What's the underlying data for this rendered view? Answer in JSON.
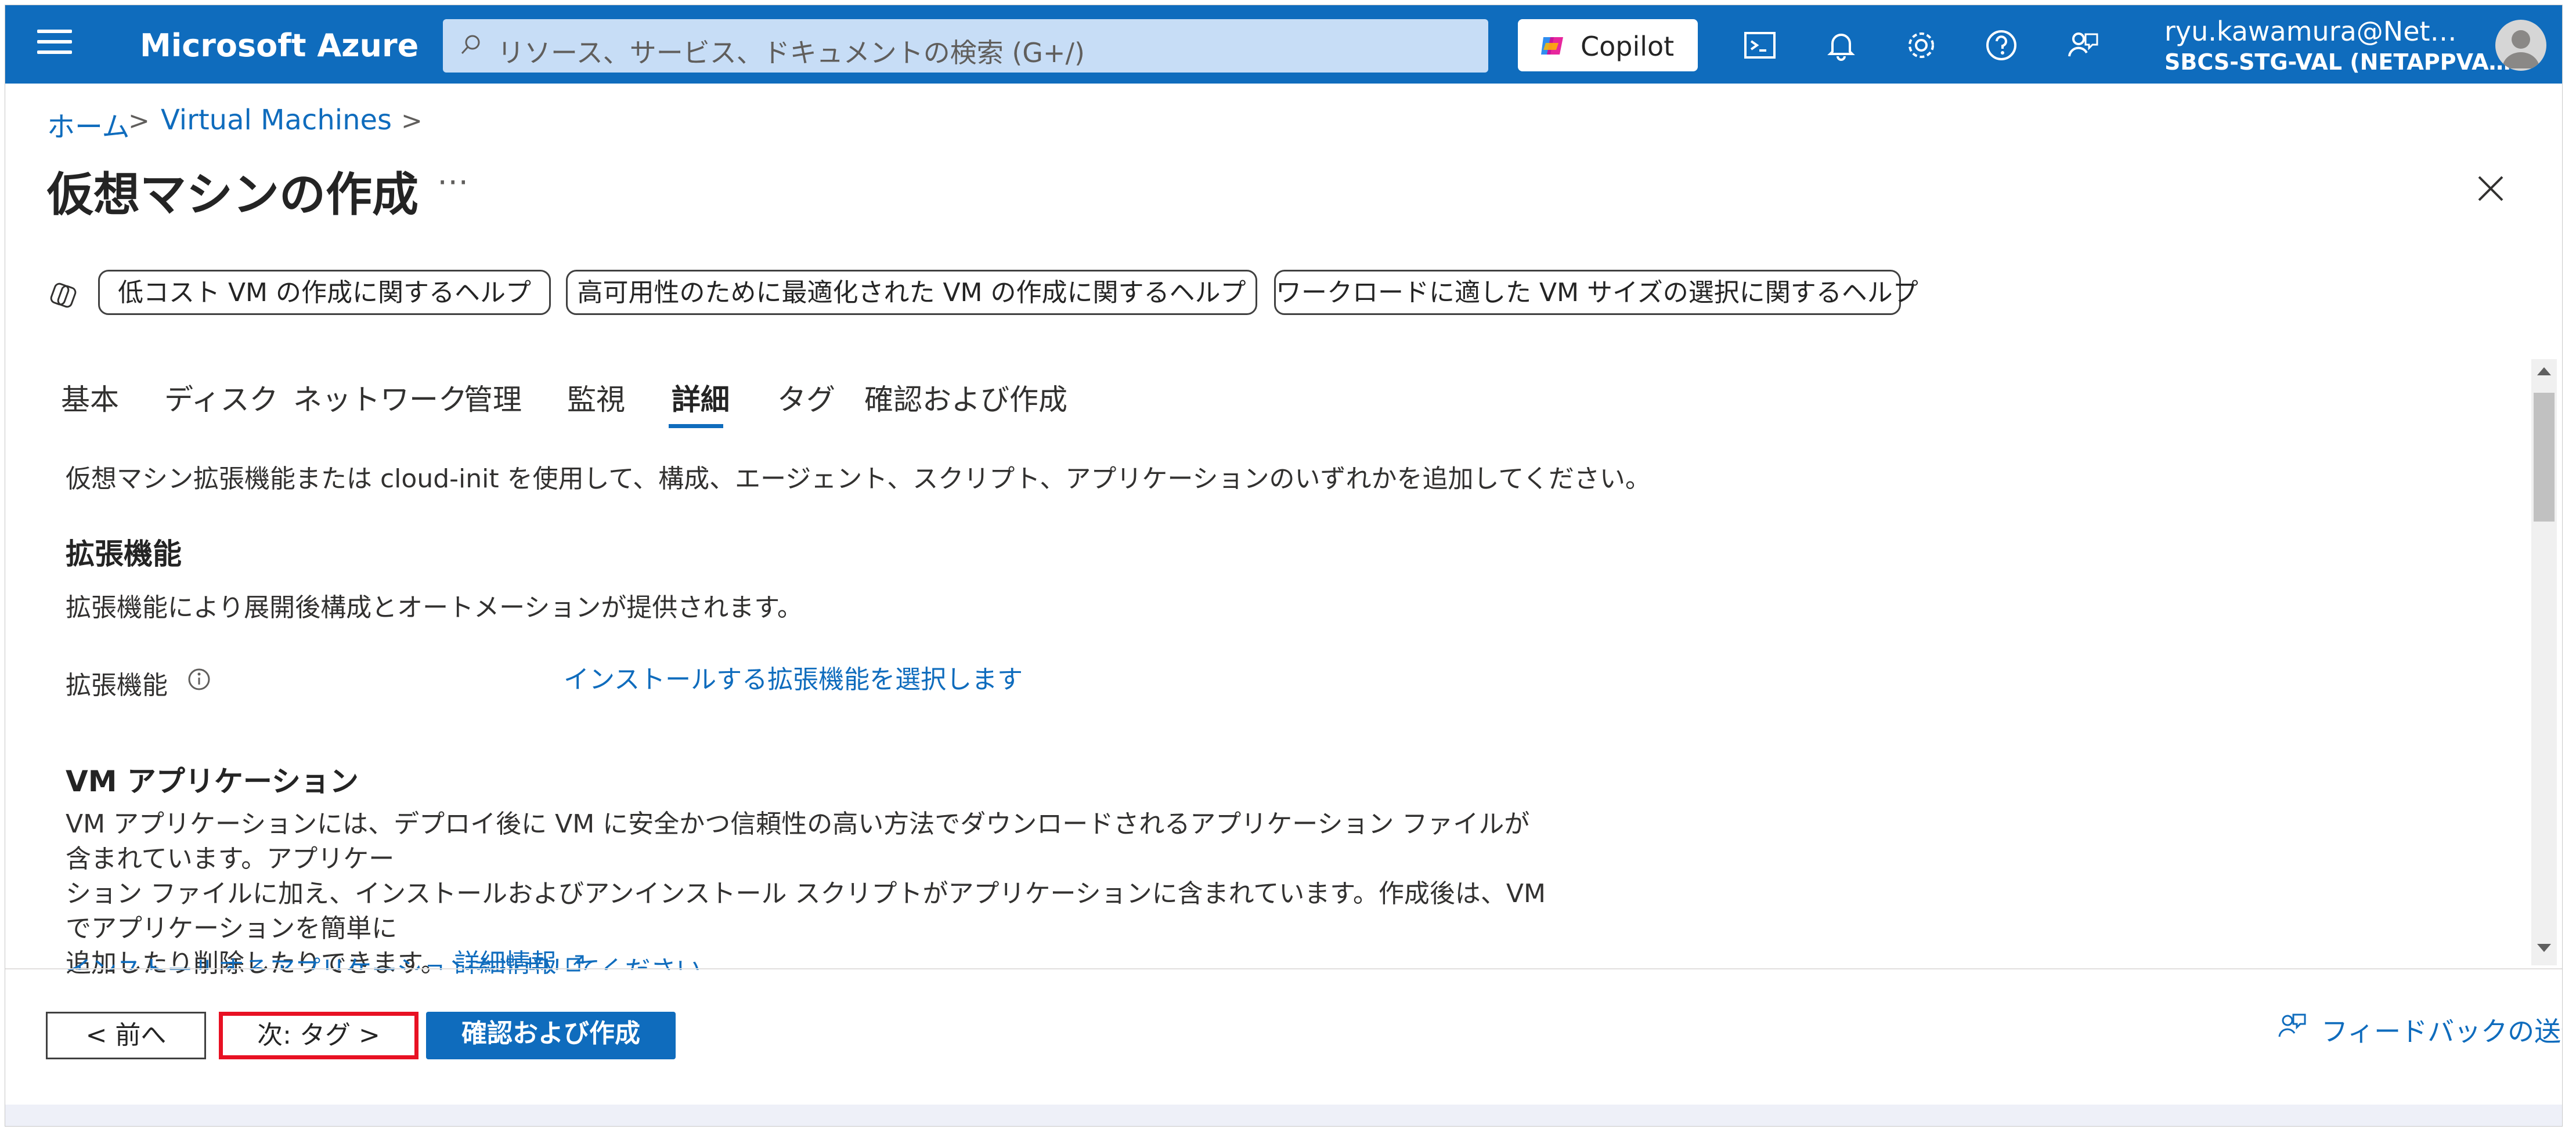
{
  "header": {
    "brand": "Microsoft Azure",
    "search_placeholder": "リソース、サービス、ドキュメントの検索 (G+/)",
    "copilot_label": "Copilot",
    "user_name": "ryu.kawamura@Net…",
    "user_tenant": "SBCS-STG-VAL (NETAPPVA…",
    "icons": [
      "menu-icon",
      "search-icon",
      "copilot-icon",
      "cloud-shell-icon",
      "notification-bell-icon",
      "settings-gear-icon",
      "help-icon",
      "feedback-icon",
      "avatar-icon"
    ],
    "colors": {
      "bar": "#0f6cbd",
      "search_bg": "#c7ddf6"
    }
  },
  "breadcrumb": {
    "items": [
      "ホーム",
      "Virtual Machines"
    ],
    "separator": ">"
  },
  "page": {
    "title": "仮想マシンの作成",
    "more": "⋯"
  },
  "help_buttons": [
    "低コスト VM の作成に関するヘルプ",
    "高可用性のために最適化された VM の作成に関するヘルプ",
    "ワークロードに適した VM サイズの選択に関するヘルプ"
  ],
  "tabs": {
    "items": [
      "基本",
      "ディスク",
      "ネットワーク",
      "管理",
      "監視",
      "詳細",
      "タグ",
      "確認および作成"
    ],
    "active": "詳細"
  },
  "content": {
    "intro": "仮想マシン拡張機能または cloud-init を使用して、構成、エージェント、スクリプト、アプリケーションのいずれかを追加してください。",
    "extensions_heading": "拡張機能",
    "extensions_desc": "拡張機能により展開後構成とオートメーションが提供されます。",
    "extensions_label": "拡張機能",
    "extensions_link": "インストールする拡張機能を選択します",
    "vmapps_heading": "VM アプリケーション",
    "vmapps_line1": "VM アプリケーションには、デプロイ後に VM に安全かつ信頼性の高い方法でダウンロードされるアプリケーション ファイルが含まれています。アプリケー",
    "vmapps_line2": "ション ファイルに加え、インストールおよびアンインストール スクリプトがアプリケーションに含まれています。作成後は、VM でアプリケーションを簡単に",
    "vmapps_line3": "追加したり削除したりできます。",
    "vmapps_learn_more": "詳細情報",
    "vmapps_select_link": "インストールするアプリケーションを選択してください"
  },
  "footer": {
    "prev": "< 前へ",
    "next": "次: タグ >",
    "create": "確認および作成",
    "feedback": "フィードバックの送信",
    "colors": {
      "primary": "#0f6cbd",
      "highlight": "#e81123"
    }
  }
}
